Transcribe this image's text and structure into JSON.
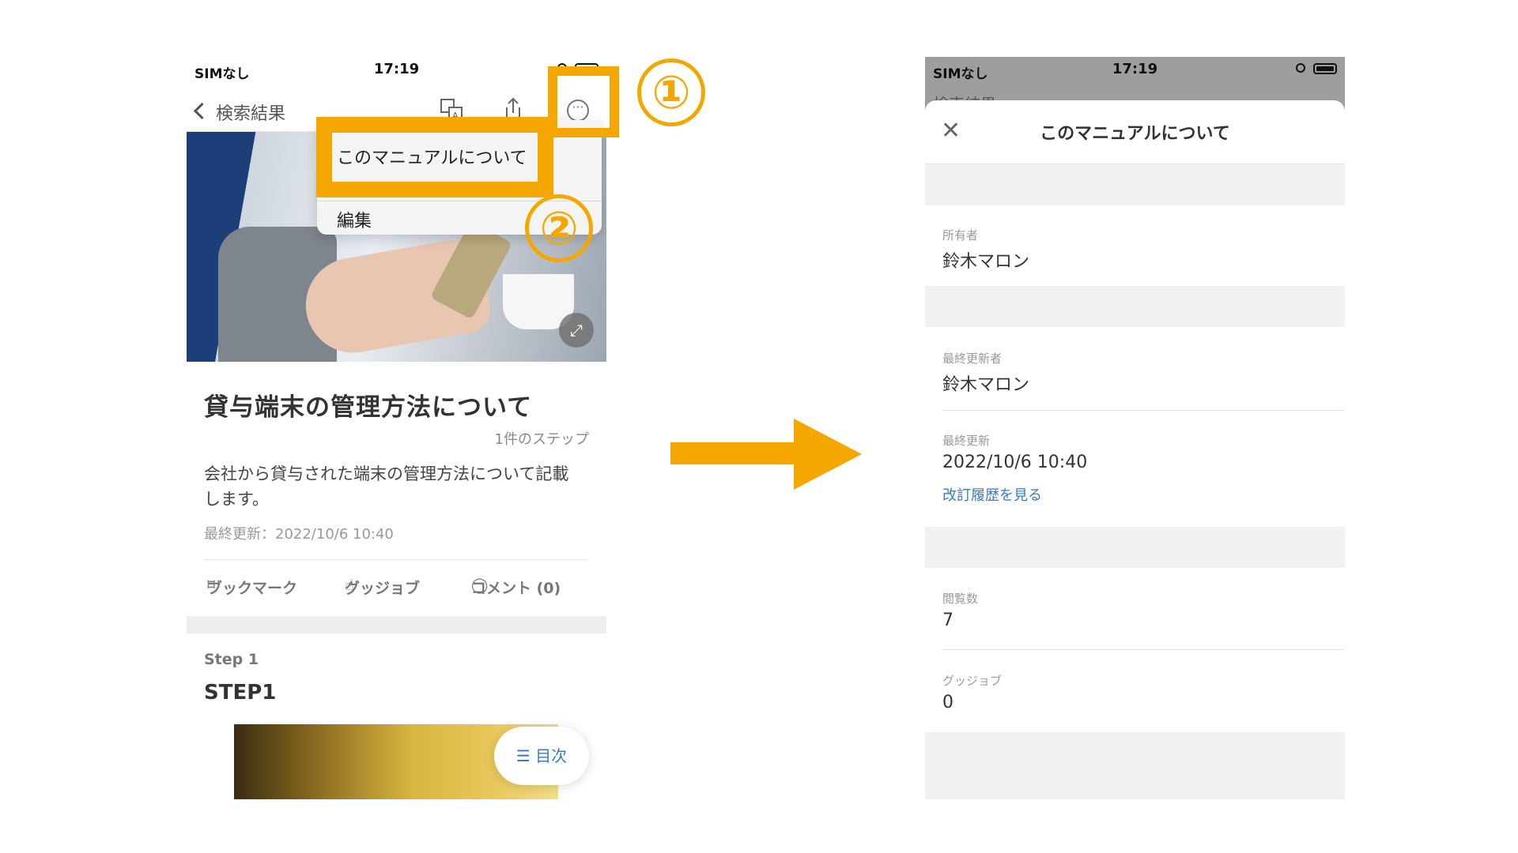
{
  "left_screen": {
    "status": {
      "carrier": "SIMなし",
      "time": "17:19"
    },
    "nav": {
      "back_label": "検索結果"
    },
    "menu": {
      "item_about": "このマニュアルについて",
      "item_edit": "編集"
    },
    "annotations": {
      "badge1": "①",
      "badge2": "②"
    },
    "manual": {
      "title": "貸与端末の管理方法について",
      "step_count": "1件のステップ",
      "description": "会社から貸与された端末の管理方法について記載します。",
      "last_updated": "最終更新：2022/10/6 10:40"
    },
    "actions": {
      "bookmark": "ブックマーク",
      "good_job": "グッジョブ",
      "comments": "コメント (0)"
    },
    "step": {
      "label": "Step 1",
      "title": "STEP1"
    },
    "toc_label": "目次"
  },
  "right_screen": {
    "status": {
      "carrier": "SIMなし",
      "time": "17:19"
    },
    "nav_partial": "検索結果",
    "sheet_title": "このマニュアルについて",
    "fields": {
      "owner_label": "所有者",
      "owner_value": "鈴木マロン",
      "last_editor_label": "最終更新者",
      "last_editor_value": "鈴木マロン",
      "last_updated_label": "最終更新",
      "last_updated_value": "2022/10/6 10:40",
      "history_link": "改訂履歴を見る",
      "views_label": "閲覧数",
      "views_value": "7",
      "goodjob_label": "グッジョブ",
      "goodjob_value": "0"
    }
  },
  "colors": {
    "highlight": "#f5a700",
    "link": "#3a7bc0"
  }
}
